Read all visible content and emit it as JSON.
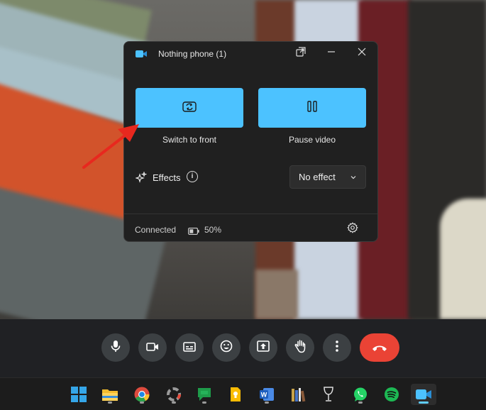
{
  "dialog": {
    "title": "Nothing phone (1)",
    "app_icon": "camera-video-icon",
    "buttons": {
      "switch_label": "Switch to front",
      "pause_label": "Pause video"
    },
    "effects": {
      "label": "Effects",
      "info_symbol": "i",
      "selected": "No effect"
    },
    "status": {
      "connection": "Connected",
      "battery": "50%"
    },
    "accent_color": "#4cc2ff"
  },
  "meet_controls": {
    "icons": [
      "mic-icon",
      "camera-icon",
      "captions-icon",
      "emoji-icon",
      "present-icon",
      "raise-hand-icon",
      "more-options-icon",
      "hang-up-icon"
    ],
    "hangup_color": "#ea4335"
  },
  "taskbar": {
    "icons": [
      "windows-start-icon",
      "file-explorer-icon",
      "chrome-icon",
      "app-icon",
      "google-chat-icon",
      "keep-icon",
      "word-icon",
      "books-app-icon",
      "wine-glass-app-icon",
      "whatsapp-icon",
      "spotify-icon",
      "phone-link-camera-icon"
    ]
  }
}
